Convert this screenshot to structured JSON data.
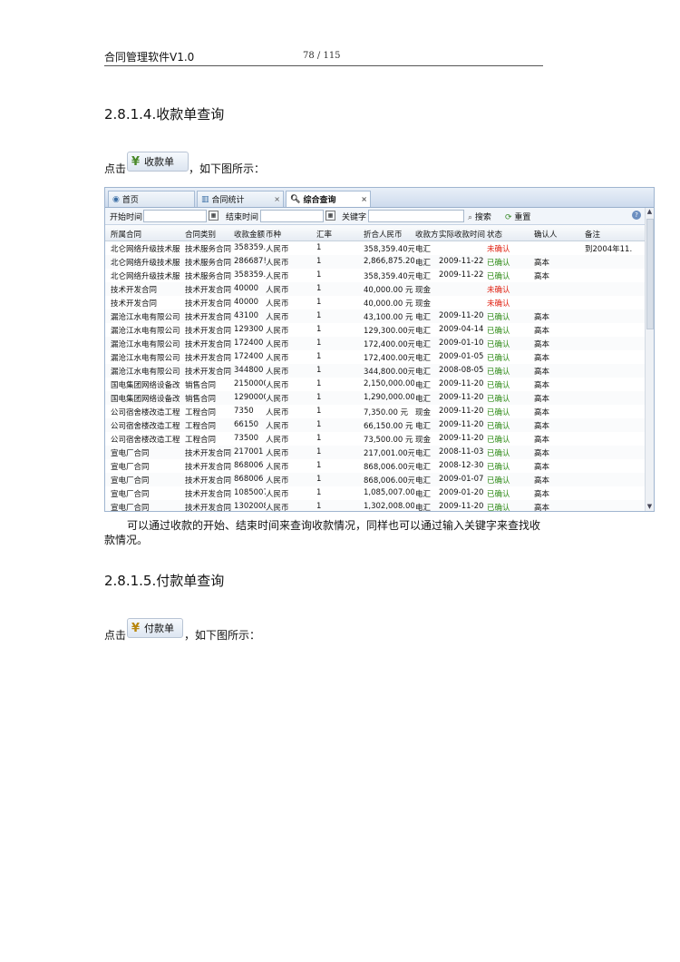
{
  "header": {
    "doc_title": "合同管理软件V1.0",
    "page_number": "78 / 115"
  },
  "section1": {
    "heading": "2.8.1.4.收款单查询",
    "click_prefix": "点击",
    "button_label": "收款单",
    "click_suffix": "，如下图所示：",
    "description_line1": "可以通过收款的开始、结束时间来查询收款情况，同样也可以通过输入关键字来查找收",
    "description_line2": "款情况。"
  },
  "section2": {
    "heading": "2.8.1.5.付款单查询",
    "click_prefix": "点击",
    "button_label": "付款单",
    "click_suffix": "，如下图所示："
  },
  "app": {
    "tabs": [
      {
        "label": "首页",
        "icon": "home-icon"
      },
      {
        "label": "合同统计",
        "icon": "chart-icon",
        "close": "×"
      },
      {
        "label": "综合查询",
        "icon": "search-icon",
        "close": "×"
      }
    ],
    "toolbar": {
      "start_label": "开始时间",
      "end_label": "结束时间",
      "keyword_label": "关键字",
      "search_label": "搜索",
      "reset_label": "重置"
    },
    "columns": [
      "所属合同",
      "合同类别",
      "收款金额",
      "币种",
      "汇率",
      "折合人民币",
      "收款方",
      "实际收款时间",
      "状态",
      "确认人",
      "备注"
    ],
    "rows": [
      [
        "北仑网络升级技术服",
        "技术服务合同",
        "358359.",
        "人民币",
        "1",
        "358,359.40元",
        "电汇",
        "",
        "未确认",
        "",
        "到2004年11."
      ],
      [
        "北仑网络升级技术服",
        "技术服务合同",
        "286687!",
        "人民币",
        "1",
        "2,866,875.20",
        "电汇",
        "2009-11-22",
        "已确认",
        "高本",
        ""
      ],
      [
        "北仑网络升级技术服",
        "技术服务合同",
        "358359.",
        "人民币",
        "1",
        "358,359.40元",
        "电汇",
        "2009-11-22",
        "已确认",
        "高本",
        ""
      ],
      [
        "技术开发合同",
        "技术开发合同",
        "40000",
        "人民币",
        "1",
        "40,000.00 元",
        "现金",
        "",
        "未确认",
        "",
        ""
      ],
      [
        "技术开发合同",
        "技术开发合同",
        "40000",
        "人民币",
        "1",
        "40,000.00 元",
        "现金",
        "",
        "未确认",
        "",
        ""
      ],
      [
        "漏沧江水电有限公司",
        "技术开发合同",
        "43100",
        "人民币",
        "1",
        "43,100.00 元",
        "电汇",
        "2009-11-20",
        "已确认",
        "高本",
        ""
      ],
      [
        "漏沧江水电有限公司",
        "技术开发合同",
        "129300",
        "人民币",
        "1",
        "129,300.00元",
        "电汇",
        "2009-04-14",
        "已确认",
        "高本",
        ""
      ],
      [
        "漏沧江水电有限公司",
        "技术开发合同",
        "172400",
        "人民币",
        "1",
        "172,400.00元",
        "电汇",
        "2009-01-10",
        "已确认",
        "高本",
        ""
      ],
      [
        "漏沧江水电有限公司",
        "技术开发合同",
        "172400",
        "人民币",
        "1",
        "172,400.00元",
        "电汇",
        "2009-01-05",
        "已确认",
        "高本",
        ""
      ],
      [
        "漏沧江水电有限公司",
        "技术开发合同",
        "344800",
        "人民币",
        "1",
        "344,800.00元",
        "电汇",
        "2008-08-05",
        "已确认",
        "高本",
        ""
      ],
      [
        "国电集团网络设备改",
        "销售合同",
        "2150000",
        "人民币",
        "1",
        "2,150,000.00",
        "电汇",
        "2009-11-20",
        "已确认",
        "高本",
        ""
      ],
      [
        "国电集团网络设备改",
        "销售合同",
        "1290000",
        "人民币",
        "1",
        "1,290,000.00",
        "电汇",
        "2009-11-20",
        "已确认",
        "高本",
        ""
      ],
      [
        "公司宿舍楼改造工程",
        "工程合同",
        "7350",
        "人民币",
        "1",
        "7,350.00 元",
        "现金",
        "2009-11-20",
        "已确认",
        "高本",
        ""
      ],
      [
        "公司宿舍楼改造工程",
        "工程合同",
        "66150",
        "人民币",
        "1",
        "66,150.00 元",
        "电汇",
        "2009-11-20",
        "已确认",
        "高本",
        ""
      ],
      [
        "公司宿舍楼改造工程",
        "工程合同",
        "73500",
        "人民币",
        "1",
        "73,500.00 元",
        "现金",
        "2009-11-20",
        "已确认",
        "高本",
        ""
      ],
      [
        "宣电厂合同",
        "技术开发合同",
        "217001",
        "人民币",
        "1",
        "217,001.00元",
        "电汇",
        "2008-11-03",
        "已确认",
        "高本",
        ""
      ],
      [
        "宣电厂合同",
        "技术开发合同",
        "868006",
        "人民币",
        "1",
        "868,006.00元",
        "电汇",
        "2008-12-30",
        "已确认",
        "高本",
        ""
      ],
      [
        "宣电厂合同",
        "技术开发合同",
        "868006",
        "人民币",
        "1",
        "868,006.00元",
        "电汇",
        "2009-01-07",
        "已确认",
        "高本",
        ""
      ],
      [
        "宣电厂合同",
        "技术开发合同",
        "1085007",
        "人民币",
        "1",
        "1,085,007.00",
        "电汇",
        "2009-01-20",
        "已确认",
        "高本",
        ""
      ],
      [
        "宣电厂合同",
        "技术开发合同",
        "1302008",
        "人民币",
        "1",
        "1,302,008.00",
        "电汇",
        "2009-11-20",
        "已确认",
        "高本",
        ""
      ]
    ],
    "status_colors": {
      "未确认": "#e02010",
      "已确认": "#2e8b16"
    }
  }
}
